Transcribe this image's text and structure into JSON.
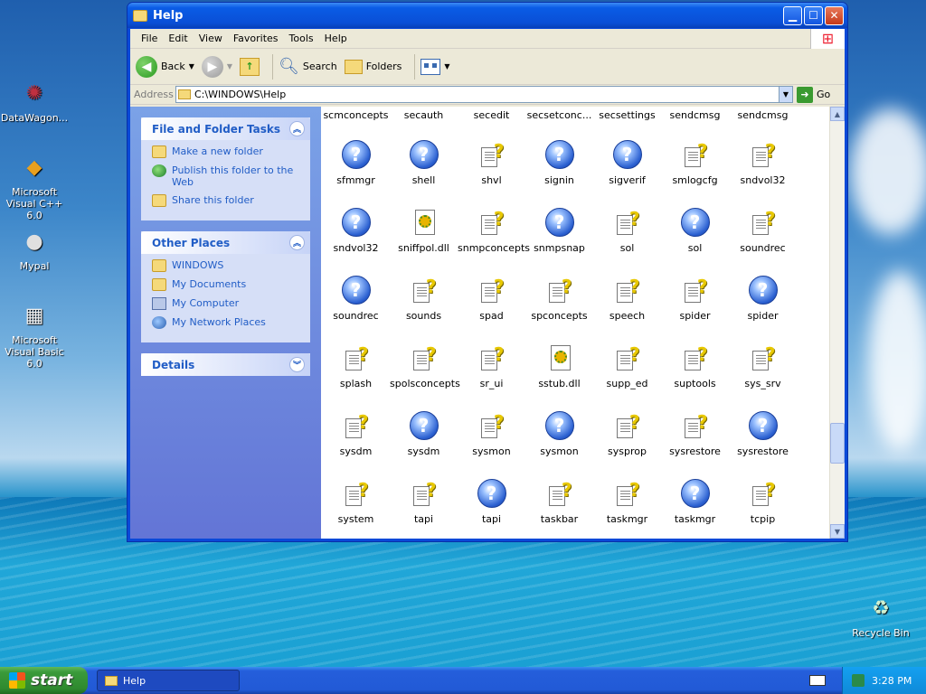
{
  "desktop": {
    "icons": [
      {
        "label": "DataWagon...",
        "icon": "datawagon-icon"
      },
      {
        "label": "Microsoft Visual C++ 6.0",
        "icon": "visual-cpp-icon"
      },
      {
        "label": "Mypal",
        "icon": "mypal-icon"
      },
      {
        "label": "Microsoft Visual Basic 6.0",
        "icon": "visual-basic-icon"
      },
      {
        "label": "Recycle Bin",
        "icon": "recycle-bin-icon"
      }
    ]
  },
  "window": {
    "title": "Help",
    "menu": [
      "File",
      "Edit",
      "View",
      "Favorites",
      "Tools",
      "Help"
    ],
    "toolbar": {
      "back": "Back",
      "search": "Search",
      "folders": "Folders"
    },
    "address": {
      "label": "Address",
      "value": "C:\\WINDOWS\\Help",
      "go": "Go"
    }
  },
  "taskpane": {
    "file_tasks": {
      "title": "File and Folder Tasks",
      "items": [
        "Make a new folder",
        "Publish this folder to the Web",
        "Share this folder"
      ]
    },
    "other_places": {
      "title": "Other Places",
      "items": [
        "WINDOWS",
        "My Documents",
        "My Computer",
        "My Network Places"
      ]
    },
    "details": {
      "title": "Details"
    }
  },
  "files": {
    "top_row": [
      "scmconcepts",
      "secauth",
      "secedit",
      "secsetconc...",
      "secsettings",
      "sendcmsg",
      "sendcmsg"
    ],
    "rows": [
      [
        {
          "name": "sfmmgr",
          "type": "help"
        },
        {
          "name": "shell",
          "type": "help"
        },
        {
          "name": "shvl",
          "type": "chm"
        },
        {
          "name": "signin",
          "type": "help"
        },
        {
          "name": "sigverif",
          "type": "help"
        },
        {
          "name": "smlogcfg",
          "type": "chm"
        },
        {
          "name": "sndvol32",
          "type": "chm"
        }
      ],
      [
        {
          "name": "sndvol32",
          "type": "help"
        },
        {
          "name": "sniffpol.dll",
          "type": "dll"
        },
        {
          "name": "snmpconcepts",
          "type": "chm"
        },
        {
          "name": "snmpsnap",
          "type": "help"
        },
        {
          "name": "sol",
          "type": "chm"
        },
        {
          "name": "sol",
          "type": "help"
        },
        {
          "name": "soundrec",
          "type": "chm"
        }
      ],
      [
        {
          "name": "soundrec",
          "type": "help"
        },
        {
          "name": "sounds",
          "type": "chm"
        },
        {
          "name": "spad",
          "type": "chm"
        },
        {
          "name": "spconcepts",
          "type": "chm"
        },
        {
          "name": "speech",
          "type": "chm"
        },
        {
          "name": "spider",
          "type": "chm"
        },
        {
          "name": "spider",
          "type": "help"
        }
      ],
      [
        {
          "name": "splash",
          "type": "chm"
        },
        {
          "name": "spolsconcepts",
          "type": "chm"
        },
        {
          "name": "sr_ui",
          "type": "chm"
        },
        {
          "name": "sstub.dll",
          "type": "dll"
        },
        {
          "name": "supp_ed",
          "type": "chm"
        },
        {
          "name": "suptools",
          "type": "chm"
        },
        {
          "name": "sys_srv",
          "type": "chm"
        }
      ],
      [
        {
          "name": "sysdm",
          "type": "chm"
        },
        {
          "name": "sysdm",
          "type": "help"
        },
        {
          "name": "sysmon",
          "type": "chm"
        },
        {
          "name": "sysmon",
          "type": "help"
        },
        {
          "name": "sysprop",
          "type": "chm"
        },
        {
          "name": "sysrestore",
          "type": "chm"
        },
        {
          "name": "sysrestore",
          "type": "help"
        }
      ],
      [
        {
          "name": "system",
          "type": "chm"
        },
        {
          "name": "tapi",
          "type": "chm"
        },
        {
          "name": "tapi",
          "type": "help"
        },
        {
          "name": "taskbar",
          "type": "chm"
        },
        {
          "name": "taskmgr",
          "type": "chm"
        },
        {
          "name": "taskmgr",
          "type": "help"
        },
        {
          "name": "tcpip",
          "type": "chm"
        }
      ]
    ]
  },
  "taskbar": {
    "start": "start",
    "active_task": "Help",
    "clock": "3:28 PM"
  }
}
